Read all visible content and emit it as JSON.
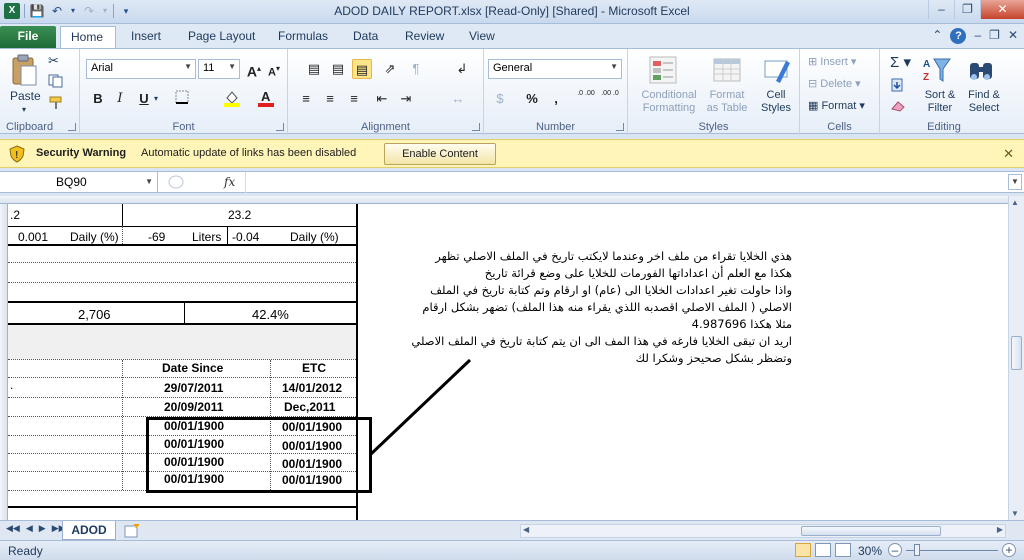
{
  "window": {
    "title": "ADOD DAILY REPORT.xlsx  [Read-Only]  [Shared]  -  Microsoft Excel",
    "qat_icons": [
      "excel-icon",
      "save-icon",
      "undo-icon",
      "redo-icon",
      "customize-icon"
    ]
  },
  "ribbon_tabs": [
    "File",
    "Home",
    "Insert",
    "Page Layout",
    "Formulas",
    "Data",
    "Review",
    "View"
  ],
  "ribbon": {
    "clipboard": {
      "label": "Clipboard",
      "paste": "Paste"
    },
    "font": {
      "label": "Font",
      "name": "Arial",
      "size": "11",
      "grow": "A",
      "shrink": "A",
      "bold": "B",
      "italic": "I",
      "underline": "U"
    },
    "alignment": {
      "label": "Alignment"
    },
    "number": {
      "label": "Number",
      "format": "General",
      "percent": "%",
      "comma": ",",
      "inc": ".0 .00",
      "dec": ".00 .0"
    },
    "styles": {
      "label": "Styles",
      "conditional": [
        "Conditional",
        "Formatting"
      ],
      "format_table": [
        "Format",
        "as Table"
      ],
      "cell_styles": [
        "Cell",
        "Styles"
      ]
    },
    "cells": {
      "label": "Cells",
      "insert": "Insert",
      "delete": "Delete",
      "format": "Format"
    },
    "editing": {
      "label": "Editing",
      "sort": [
        "Sort &",
        "Filter"
      ],
      "find": [
        "Find &",
        "Select"
      ]
    }
  },
  "security": {
    "title": "Security Warning",
    "message": "Automatic update of links has been disabled",
    "button": "Enable Content"
  },
  "formula_bar": {
    "name_box": "BQ90",
    "fx": "fx",
    "content": ""
  },
  "sheet": {
    "r1": {
      "a": ".2",
      "b": "23.2"
    },
    "r2": {
      "c1": "0.001",
      "c2": "Daily (%)",
      "c3": "-69",
      "c4": "Liters",
      "c5": "-0.04",
      "c6": "Daily (%)"
    },
    "r3": {
      "a": "2,706",
      "b": "42.4%"
    },
    "headers": {
      "date_since": "Date Since",
      "etc": "ETC"
    },
    "rows": [
      {
        "lead": ".",
        "date": "29/07/2011",
        "etc": "14/01/2012"
      },
      {
        "lead": "",
        "date": "20/09/2011",
        "etc": "Dec,2011"
      },
      {
        "lead": "",
        "date": "00/01/1900",
        "etc": "00/01/1900"
      },
      {
        "lead": "",
        "date": "00/01/1900",
        "etc": "00/01/1900"
      },
      {
        "lead": "",
        "date": "00/01/1900",
        "etc": "00/01/1900"
      },
      {
        "lead": "",
        "date": "00/01/1900",
        "etc": "00/01/1900"
      }
    ],
    "note_lines": [
      "هذي الخلايا تقراء من ملف اخر وعندما لايكتب تاريخ في الملف الاصلي تظهر",
      "هكذا مع العلم أن اعداداتها الفورمات للخلايا على وضع قرائة تاريخ",
      "واذا حاولت تغير اعدادات الخلايا الى (عام) او ارقام وتم كتابة تاريخ في الملف",
      "الاصلي ( الملف الاصلي اقصدبه اللذي يقراء منه هذا الملف) تضهر بشكل ارقام",
      "مثلا هكذا 4.987696",
      "اريد ان تبقى الخلايا فارغه في هذا المف الى ان يتم كتابة تاريخ في الملف الاصلي",
      "وتضظر بشكل صحيحز وشكرا لك"
    ]
  },
  "sheet_tabs": [
    "ADOD"
  ],
  "status": {
    "ready": "Ready",
    "zoom": "30%"
  }
}
